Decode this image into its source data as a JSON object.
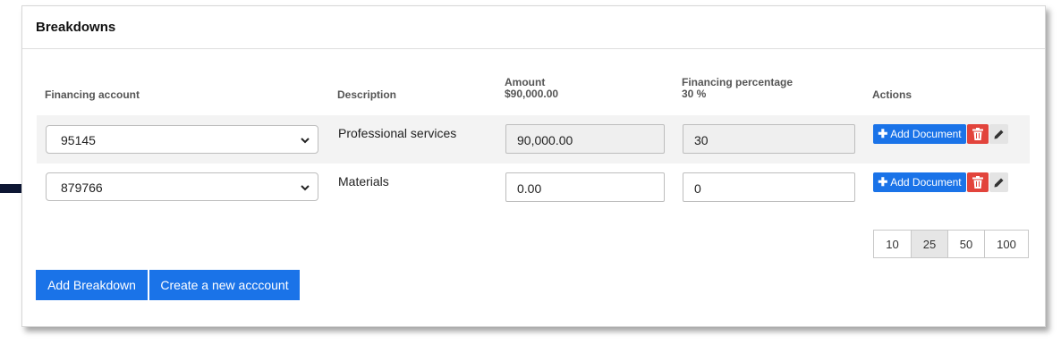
{
  "panel": {
    "title": "Breakdowns"
  },
  "columns": {
    "financing_account": "Financing account",
    "description": "Description",
    "amount_label": "Amount",
    "amount_total": "$90,000.00",
    "percentage_label": "Financing percentage",
    "percentage_total": "30 %",
    "actions": "Actions"
  },
  "rows": [
    {
      "account": "95145",
      "description": "Professional services",
      "amount": "90,000.00",
      "percentage": "30",
      "amount_readonly": true
    },
    {
      "account": "879766",
      "description": "Materials",
      "amount": "0.00",
      "percentage": "0",
      "amount_readonly": false
    }
  ],
  "row_actions": {
    "add_document_label": "Add Document",
    "delete_icon": "trash-icon",
    "edit_icon": "pencil-icon"
  },
  "pagination": {
    "options": [
      "10",
      "25",
      "50",
      "100"
    ],
    "selected": "25"
  },
  "buttons": {
    "add_breakdown": "Add Breakdown",
    "create_account": "Create a new acccount"
  },
  "colors": {
    "primary": "#1a73e8",
    "danger": "#e2443c",
    "arrow": "#0d1633"
  }
}
